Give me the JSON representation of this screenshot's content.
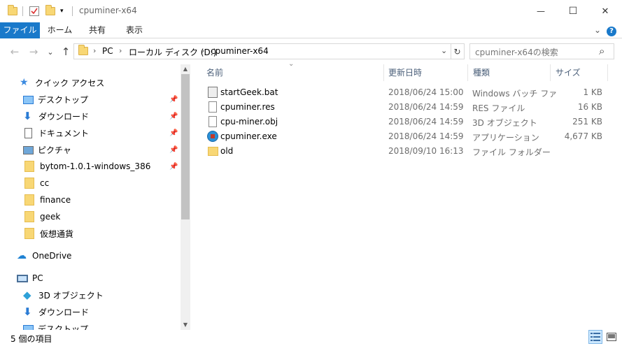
{
  "window": {
    "title": "cpuminer-x64",
    "minimize_glyph": "—",
    "maximize_glyph": "☐",
    "close_glyph": "✕"
  },
  "ribbon": {
    "tabs": [
      "ファイル",
      "ホーム",
      "共有",
      "表示"
    ],
    "expand_glyph": "⌄",
    "help_glyph": "?"
  },
  "address": {
    "back_glyph": "←",
    "forward_glyph": "→",
    "history_glyph": "⌄",
    "up_glyph": "↑",
    "crumbs": [
      "PC",
      "ローカル ディスク (D:)",
      "cpuminer-x64"
    ],
    "sep_glyph": "›",
    "dropdown_glyph": "⌄",
    "refresh_glyph": "↻"
  },
  "search": {
    "placeholder": "cpuminer-x64の検索",
    "icon_glyph": "⌕"
  },
  "nav": {
    "quick_access": "クイック アクセス",
    "items": [
      {
        "label": "デスクトップ",
        "pinned": true
      },
      {
        "label": "ダウンロード",
        "pinned": true
      },
      {
        "label": "ドキュメント",
        "pinned": true
      },
      {
        "label": "ピクチャ",
        "pinned": true
      },
      {
        "label": "bytom-1.0.1-windows_386",
        "pinned": true
      },
      {
        "label": "cc",
        "pinned": false
      },
      {
        "label": "finance",
        "pinned": false
      },
      {
        "label": "geek",
        "pinned": false
      },
      {
        "label": "仮想通貨",
        "pinned": false
      }
    ],
    "onedrive": "OneDrive",
    "pc": "PC",
    "pc_items": [
      "3D オブジェクト",
      "ダウンロード",
      "デスクトップ"
    ],
    "pin_glyph": "📌"
  },
  "columns": {
    "name": "名前",
    "date": "更新日時",
    "type": "種類",
    "size": "サイズ",
    "sort_glyph": "⌄"
  },
  "files": [
    {
      "name": "startGeek.bat",
      "date": "2018/06/24 15:00",
      "type": "Windows バッチ ファ",
      "size": "1 KB",
      "icon": "batch-file-icon"
    },
    {
      "name": "cpuminer.res",
      "date": "2018/06/24 14:59",
      "type": "RES ファイル",
      "size": "16 KB",
      "icon": "file-icon"
    },
    {
      "name": "cpu-miner.obj",
      "date": "2018/06/24 14:59",
      "type": "3D オブジェクト",
      "size": "251 KB",
      "icon": "file-icon"
    },
    {
      "name": "cpuminer.exe",
      "date": "2018/06/24 14:59",
      "type": "アプリケーション",
      "size": "4,677 KB",
      "icon": "exe-icon"
    },
    {
      "name": "old",
      "date": "2018/09/10 16:13",
      "type": "ファイル フォルダー",
      "size": "",
      "icon": "folder-icon"
    }
  ],
  "status": {
    "count": "5 個の項目"
  }
}
